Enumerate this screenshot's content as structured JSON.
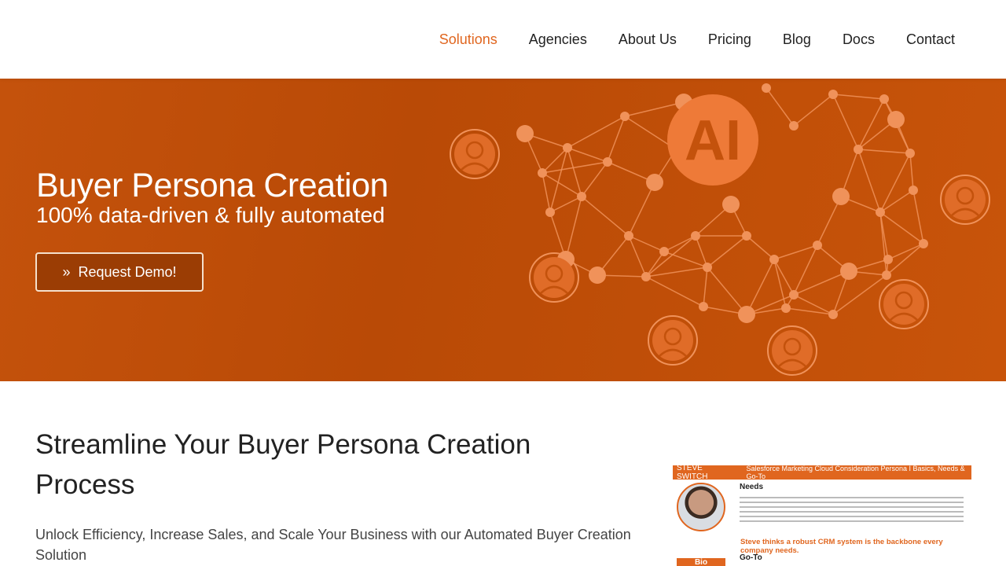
{
  "nav": {
    "items": [
      {
        "label": "Solutions",
        "active": true
      },
      {
        "label": "Agencies"
      },
      {
        "label": "About Us"
      },
      {
        "label": "Pricing"
      },
      {
        "label": "Blog"
      },
      {
        "label": "Docs"
      },
      {
        "label": "Contact"
      }
    ]
  },
  "hero": {
    "title": "Buyer Persona Creation",
    "subtitle": "100% data-driven & fully automated",
    "cta_label": "Request Demo!",
    "cta_icon": "double-chevron-right-icon",
    "graphic_label": "AI"
  },
  "main": {
    "heading": "Streamline Your Buyer Persona Creation Process",
    "text": "Unlock Efficiency, Increase Sales, and Scale Your Business with our Automated Buyer Creation Solution"
  },
  "persona_card": {
    "name": "STEVE SWITCH",
    "header": "Salesforce Marketing Cloud Consideration Persona I Basics, Needs & Go-To",
    "needs_title": "Needs",
    "quote": "Steve thinks a robust CRM system is the backbone every company needs.",
    "goto_title": "Go-To",
    "bio_label": "Bio"
  },
  "colors": {
    "accent": "#e0661f",
    "hero_bg": "#c4520c"
  }
}
